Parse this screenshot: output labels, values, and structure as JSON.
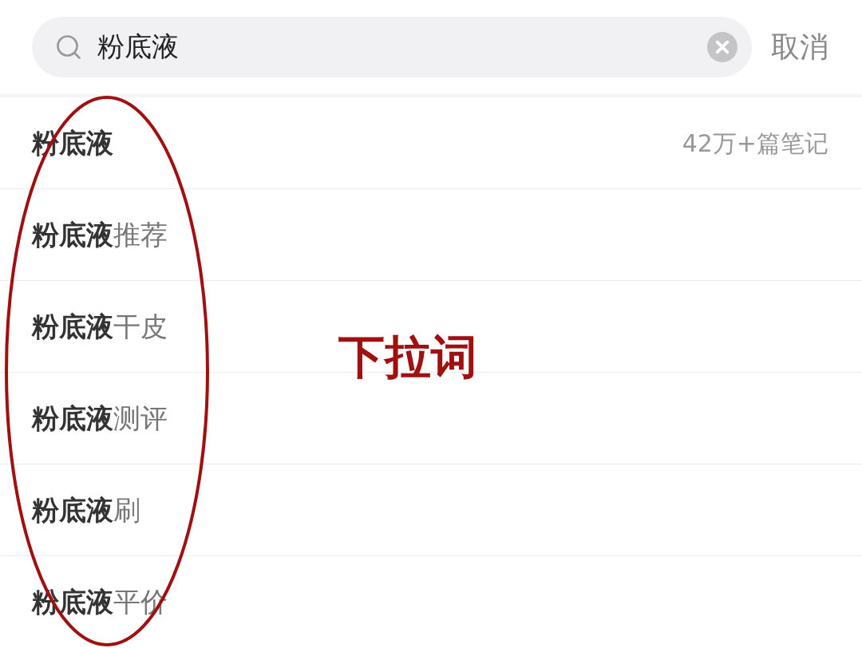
{
  "search": {
    "value": "粉底液",
    "cancel": "取消"
  },
  "suggestions": [
    {
      "text": "**粉底液**",
      "count": "42万+篇笔记"
    },
    {
      "text": "**粉底液**推荐"
    },
    {
      "text": "**粉底液**干皮"
    },
    {
      "text": "**粉底液**测评"
    },
    {
      "text": "**粉底液**刷"
    },
    {
      "text": "**粉底液**平价"
    }
  ],
  "annotation": {
    "label": "下拉词"
  }
}
